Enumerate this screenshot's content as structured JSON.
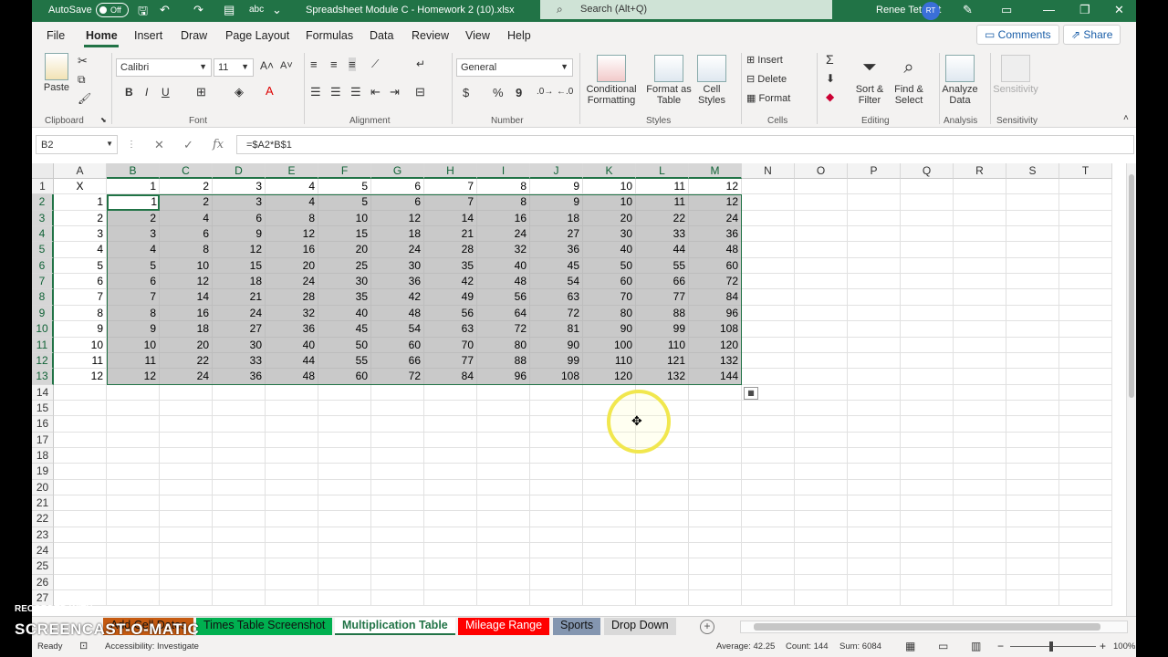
{
  "titlebar": {
    "autosave_label": "AutoSave",
    "autosave_state": "Off",
    "doc_title": "Spreadsheet Module C - Homework 2 (10).xlsx",
    "search_placeholder": "Search (Alt+Q)",
    "user_name": "Renee Tetrault",
    "user_initials": "RT",
    "accent_color": "#217346"
  },
  "menu": {
    "items": [
      "File",
      "Home",
      "Insert",
      "Draw",
      "Page Layout",
      "Formulas",
      "Data",
      "Review",
      "View",
      "Help"
    ],
    "active": "Home",
    "comments_label": "Comments",
    "share_label": "Share"
  },
  "ribbon": {
    "clipboard": {
      "paste": "Paste",
      "label": "Clipboard"
    },
    "font": {
      "name": "Calibri",
      "size": "11",
      "bold": "B",
      "italic": "I",
      "underline": "U",
      "label": "Font"
    },
    "alignment": {
      "label": "Alignment"
    },
    "number": {
      "format": "General",
      "currency": "$",
      "percent": "%",
      "comma": "9",
      "label": "Number"
    },
    "styles": {
      "conditional": "Conditional",
      "conditional2": "Formatting",
      "format_table": "Format as",
      "format_table2": "Table",
      "cell_styles": "Cell",
      "cell_styles2": "Styles",
      "label": "Styles"
    },
    "cells": {
      "insert": "Insert",
      "delete": "Delete",
      "format": "Format",
      "label": "Cells"
    },
    "editing": {
      "sort": "Sort &",
      "sort2": "Filter",
      "find": "Find &",
      "find2": "Select",
      "label": "Editing"
    },
    "analysis": {
      "analyze": "Analyze",
      "analyze2": "Data",
      "label": "Analysis"
    },
    "sensitivity": {
      "btn": "Sensitivity",
      "label": "Sensitivity"
    }
  },
  "formula_bar": {
    "name_box": "B2",
    "formula": "=$A2*B$1"
  },
  "sheet": {
    "columns": [
      "A",
      "B",
      "C",
      "D",
      "E",
      "F",
      "G",
      "H",
      "I",
      "J",
      "K",
      "L",
      "M",
      "N",
      "O",
      "P",
      "Q",
      "R",
      "S",
      "T"
    ],
    "rows": [
      "1",
      "2",
      "3",
      "4",
      "5",
      "6",
      "7",
      "8",
      "9",
      "10",
      "11",
      "12",
      "13",
      "14",
      "15",
      "16",
      "17",
      "18",
      "19",
      "20",
      "21",
      "22",
      "23",
      "24",
      "25",
      "26",
      "27"
    ],
    "a1": "X",
    "header_row": [
      "1",
      "2",
      "3",
      "4",
      "5",
      "6",
      "7",
      "8",
      "9",
      "10",
      "11",
      "12"
    ],
    "row_labels": [
      "1",
      "2",
      "3",
      "4",
      "5",
      "6",
      "7",
      "8",
      "9",
      "10",
      "11",
      "12"
    ],
    "body": [
      [
        "1",
        "2",
        "3",
        "4",
        "5",
        "6",
        "7",
        "8",
        "9",
        "10",
        "11",
        "12"
      ],
      [
        "2",
        "4",
        "6",
        "8",
        "10",
        "12",
        "14",
        "16",
        "18",
        "20",
        "22",
        "24"
      ],
      [
        "3",
        "6",
        "9",
        "12",
        "15",
        "18",
        "21",
        "24",
        "27",
        "30",
        "33",
        "36"
      ],
      [
        "4",
        "8",
        "12",
        "16",
        "20",
        "24",
        "28",
        "32",
        "36",
        "40",
        "44",
        "48"
      ],
      [
        "5",
        "10",
        "15",
        "20",
        "25",
        "30",
        "35",
        "40",
        "45",
        "50",
        "55",
        "60"
      ],
      [
        "6",
        "12",
        "18",
        "24",
        "30",
        "36",
        "42",
        "48",
        "54",
        "60",
        "66",
        "72"
      ],
      [
        "7",
        "14",
        "21",
        "28",
        "35",
        "42",
        "49",
        "56",
        "63",
        "70",
        "77",
        "84"
      ],
      [
        "8",
        "16",
        "24",
        "32",
        "40",
        "48",
        "56",
        "64",
        "72",
        "80",
        "88",
        "96"
      ],
      [
        "9",
        "18",
        "27",
        "36",
        "45",
        "54",
        "63",
        "72",
        "81",
        "90",
        "99",
        "108"
      ],
      [
        "10",
        "20",
        "30",
        "40",
        "50",
        "60",
        "70",
        "80",
        "90",
        "100",
        "110",
        "120"
      ],
      [
        "11",
        "22",
        "33",
        "44",
        "55",
        "66",
        "77",
        "88",
        "99",
        "110",
        "121",
        "132"
      ],
      [
        "12",
        "24",
        "36",
        "48",
        "60",
        "72",
        "84",
        "96",
        "108",
        "120",
        "132",
        "144"
      ]
    ]
  },
  "tabs": [
    {
      "label": "Add Cell Dates",
      "color": "#c55a11"
    },
    {
      "label": "Times Table Screenshot",
      "color": "#00b050"
    },
    {
      "label": "Multiplication Table",
      "color": "#ffffff"
    },
    {
      "label": "Mileage Range",
      "color": "#ff0000"
    },
    {
      "label": "Sports",
      "color": "#8496b0"
    },
    {
      "label": "Drop Down",
      "color": "#d9d9d9"
    }
  ],
  "status": {
    "ready": "Ready",
    "accessibility": "Accessibility: Investigate",
    "average": "Average: 42.25",
    "count": "Count: 144",
    "sum": "Sum: 6084",
    "zoom": "100%"
  },
  "watermark": {
    "line1": "RECORDED WITH",
    "line2": "SCREENCAST-O-MATIC"
  }
}
